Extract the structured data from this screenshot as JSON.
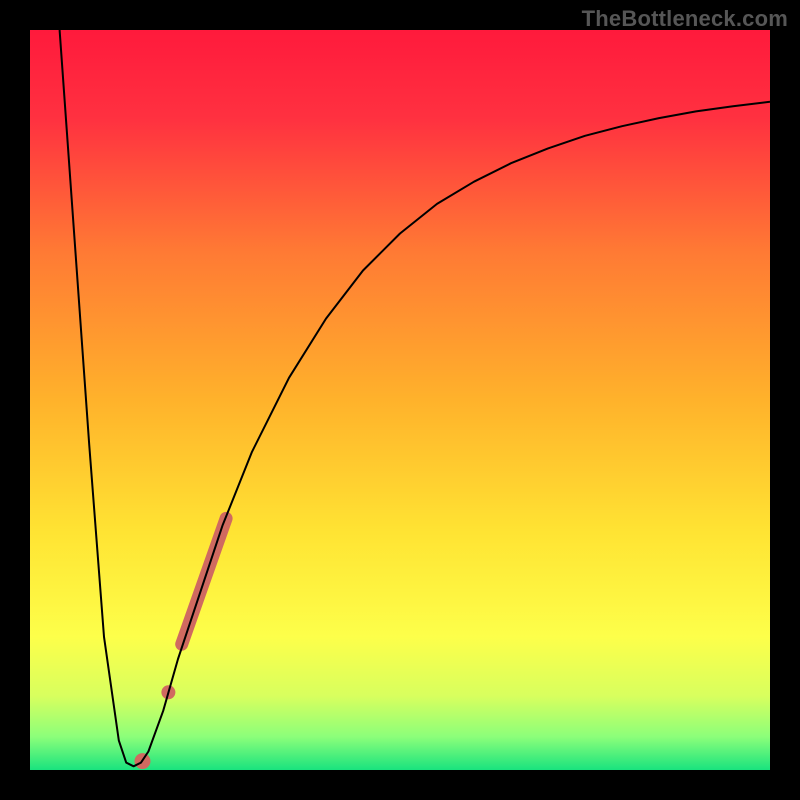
{
  "watermark": "TheBottleneck.com",
  "chart_data": {
    "type": "line",
    "title": "",
    "xlabel": "",
    "ylabel": "",
    "xlim": [
      0,
      100
    ],
    "ylim": [
      0,
      100
    ],
    "grid": false,
    "legend": false,
    "background": {
      "type": "vertical-gradient",
      "stops": [
        {
          "pos": 0.0,
          "color": "#ff1a3c"
        },
        {
          "pos": 0.12,
          "color": "#ff3140"
        },
        {
          "pos": 0.3,
          "color": "#ff7a34"
        },
        {
          "pos": 0.5,
          "color": "#ffb22b"
        },
        {
          "pos": 0.68,
          "color": "#ffe433"
        },
        {
          "pos": 0.82,
          "color": "#fdff4a"
        },
        {
          "pos": 0.9,
          "color": "#d8ff5e"
        },
        {
          "pos": 0.955,
          "color": "#8cff7a"
        },
        {
          "pos": 1.0,
          "color": "#19e37e"
        }
      ]
    },
    "series": [
      {
        "name": "bottleneck-curve",
        "stroke": "#000000",
        "stroke_width": 2,
        "x": [
          4,
          6,
          8,
          10,
          12,
          13,
          14,
          15,
          16,
          18,
          20,
          23,
          26,
          30,
          35,
          40,
          45,
          50,
          55,
          60,
          65,
          70,
          75,
          80,
          85,
          90,
          95,
          100
        ],
        "y": [
          100,
          72,
          44,
          18,
          4,
          1,
          0.5,
          1,
          2.5,
          8,
          15,
          24,
          33,
          43,
          53,
          61,
          67.5,
          72.5,
          76.5,
          79.5,
          82,
          84,
          85.7,
          87,
          88.1,
          89,
          89.7,
          90.3
        ]
      }
    ],
    "markers": [
      {
        "name": "highlight-segment",
        "type": "thick-line",
        "color": "#d06a60",
        "width": 13,
        "x": [
          20.5,
          26.5
        ],
        "y": [
          17,
          34
        ]
      },
      {
        "name": "highlight-dot-1",
        "type": "dot",
        "color": "#d06a60",
        "radius": 7,
        "x": 18.7,
        "y": 10.5
      },
      {
        "name": "highlight-dot-2",
        "type": "dot",
        "color": "#d06a60",
        "radius": 8,
        "x": 15.2,
        "y": 1.2
      }
    ]
  }
}
